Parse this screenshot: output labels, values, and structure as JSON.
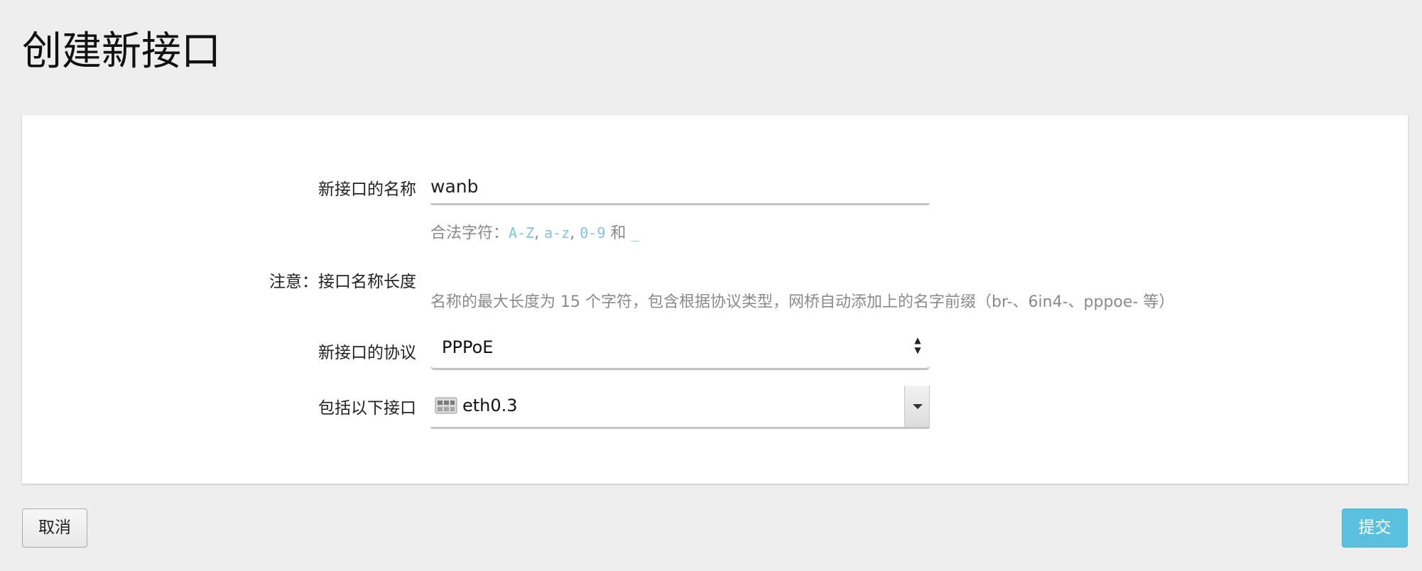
{
  "page": {
    "title": "创建新接口"
  },
  "form": {
    "name": {
      "label": "新接口的名称",
      "value": "wanb",
      "hint": [
        {
          "text": "合法字符：",
          "code": false
        },
        {
          "text": "A-Z",
          "code": true
        },
        {
          "text": ", ",
          "code": false
        },
        {
          "text": "a-z",
          "code": true
        },
        {
          "text": ", ",
          "code": false
        },
        {
          "text": "0-9",
          "code": true
        },
        {
          "text": " 和 ",
          "code": false
        },
        {
          "text": "_",
          "code": true
        }
      ]
    },
    "note": {
      "label": "注意：接口名称长度",
      "text": "名称的最大长度为 15 个字符，包含根据协议类型，网桥自动添加上的名字前缀（br-、6in4-、pppoe- 等）"
    },
    "protocol": {
      "label": "新接口的协议",
      "value": "PPPoE",
      "icon": "up-down-arrows-icon"
    },
    "interfaces": {
      "label": "包括以下接口",
      "value": "eth0.3",
      "icon": "ethernet-port-icon",
      "dropdown_icon": "caret-down-icon"
    }
  },
  "actions": {
    "cancel": "取消",
    "submit": "提交"
  },
  "colors": {
    "background": "#eeeeee",
    "card": "#ffffff",
    "code_text": "#7ec3df",
    "submit_button": "#5bc0de",
    "hint_text": "#8a8a8a"
  }
}
